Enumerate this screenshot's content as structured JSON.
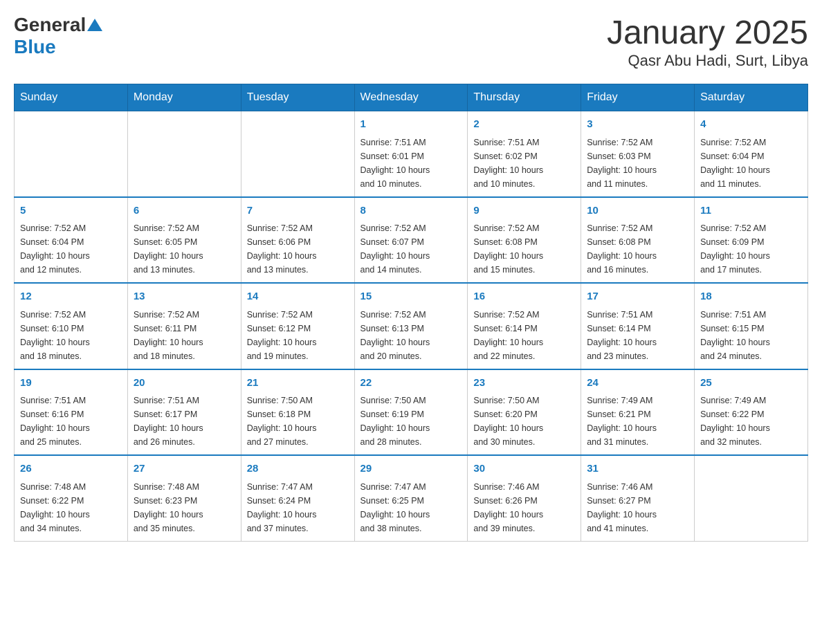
{
  "header": {
    "logo_general": "General",
    "logo_blue": "Blue",
    "month_title": "January 2025",
    "location": "Qasr Abu Hadi, Surt, Libya"
  },
  "weekdays": [
    "Sunday",
    "Monday",
    "Tuesday",
    "Wednesday",
    "Thursday",
    "Friday",
    "Saturday"
  ],
  "weeks": [
    [
      {
        "day": "",
        "info": ""
      },
      {
        "day": "",
        "info": ""
      },
      {
        "day": "",
        "info": ""
      },
      {
        "day": "1",
        "info": "Sunrise: 7:51 AM\nSunset: 6:01 PM\nDaylight: 10 hours\nand 10 minutes."
      },
      {
        "day": "2",
        "info": "Sunrise: 7:51 AM\nSunset: 6:02 PM\nDaylight: 10 hours\nand 10 minutes."
      },
      {
        "day": "3",
        "info": "Sunrise: 7:52 AM\nSunset: 6:03 PM\nDaylight: 10 hours\nand 11 minutes."
      },
      {
        "day": "4",
        "info": "Sunrise: 7:52 AM\nSunset: 6:04 PM\nDaylight: 10 hours\nand 11 minutes."
      }
    ],
    [
      {
        "day": "5",
        "info": "Sunrise: 7:52 AM\nSunset: 6:04 PM\nDaylight: 10 hours\nand 12 minutes."
      },
      {
        "day": "6",
        "info": "Sunrise: 7:52 AM\nSunset: 6:05 PM\nDaylight: 10 hours\nand 13 minutes."
      },
      {
        "day": "7",
        "info": "Sunrise: 7:52 AM\nSunset: 6:06 PM\nDaylight: 10 hours\nand 13 minutes."
      },
      {
        "day": "8",
        "info": "Sunrise: 7:52 AM\nSunset: 6:07 PM\nDaylight: 10 hours\nand 14 minutes."
      },
      {
        "day": "9",
        "info": "Sunrise: 7:52 AM\nSunset: 6:08 PM\nDaylight: 10 hours\nand 15 minutes."
      },
      {
        "day": "10",
        "info": "Sunrise: 7:52 AM\nSunset: 6:08 PM\nDaylight: 10 hours\nand 16 minutes."
      },
      {
        "day": "11",
        "info": "Sunrise: 7:52 AM\nSunset: 6:09 PM\nDaylight: 10 hours\nand 17 minutes."
      }
    ],
    [
      {
        "day": "12",
        "info": "Sunrise: 7:52 AM\nSunset: 6:10 PM\nDaylight: 10 hours\nand 18 minutes."
      },
      {
        "day": "13",
        "info": "Sunrise: 7:52 AM\nSunset: 6:11 PM\nDaylight: 10 hours\nand 18 minutes."
      },
      {
        "day": "14",
        "info": "Sunrise: 7:52 AM\nSunset: 6:12 PM\nDaylight: 10 hours\nand 19 minutes."
      },
      {
        "day": "15",
        "info": "Sunrise: 7:52 AM\nSunset: 6:13 PM\nDaylight: 10 hours\nand 20 minutes."
      },
      {
        "day": "16",
        "info": "Sunrise: 7:52 AM\nSunset: 6:14 PM\nDaylight: 10 hours\nand 22 minutes."
      },
      {
        "day": "17",
        "info": "Sunrise: 7:51 AM\nSunset: 6:14 PM\nDaylight: 10 hours\nand 23 minutes."
      },
      {
        "day": "18",
        "info": "Sunrise: 7:51 AM\nSunset: 6:15 PM\nDaylight: 10 hours\nand 24 minutes."
      }
    ],
    [
      {
        "day": "19",
        "info": "Sunrise: 7:51 AM\nSunset: 6:16 PM\nDaylight: 10 hours\nand 25 minutes."
      },
      {
        "day": "20",
        "info": "Sunrise: 7:51 AM\nSunset: 6:17 PM\nDaylight: 10 hours\nand 26 minutes."
      },
      {
        "day": "21",
        "info": "Sunrise: 7:50 AM\nSunset: 6:18 PM\nDaylight: 10 hours\nand 27 minutes."
      },
      {
        "day": "22",
        "info": "Sunrise: 7:50 AM\nSunset: 6:19 PM\nDaylight: 10 hours\nand 28 minutes."
      },
      {
        "day": "23",
        "info": "Sunrise: 7:50 AM\nSunset: 6:20 PM\nDaylight: 10 hours\nand 30 minutes."
      },
      {
        "day": "24",
        "info": "Sunrise: 7:49 AM\nSunset: 6:21 PM\nDaylight: 10 hours\nand 31 minutes."
      },
      {
        "day": "25",
        "info": "Sunrise: 7:49 AM\nSunset: 6:22 PM\nDaylight: 10 hours\nand 32 minutes."
      }
    ],
    [
      {
        "day": "26",
        "info": "Sunrise: 7:48 AM\nSunset: 6:22 PM\nDaylight: 10 hours\nand 34 minutes."
      },
      {
        "day": "27",
        "info": "Sunrise: 7:48 AM\nSunset: 6:23 PM\nDaylight: 10 hours\nand 35 minutes."
      },
      {
        "day": "28",
        "info": "Sunrise: 7:47 AM\nSunset: 6:24 PM\nDaylight: 10 hours\nand 37 minutes."
      },
      {
        "day": "29",
        "info": "Sunrise: 7:47 AM\nSunset: 6:25 PM\nDaylight: 10 hours\nand 38 minutes."
      },
      {
        "day": "30",
        "info": "Sunrise: 7:46 AM\nSunset: 6:26 PM\nDaylight: 10 hours\nand 39 minutes."
      },
      {
        "day": "31",
        "info": "Sunrise: 7:46 AM\nSunset: 6:27 PM\nDaylight: 10 hours\nand 41 minutes."
      },
      {
        "day": "",
        "info": ""
      }
    ]
  ]
}
